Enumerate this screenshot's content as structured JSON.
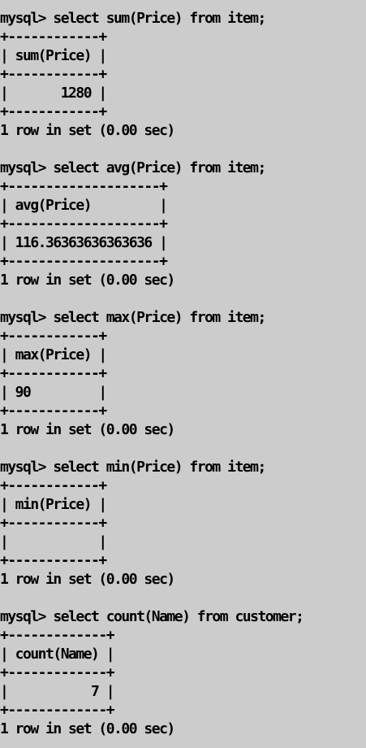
{
  "terminal": {
    "lines": [
      "mysql> select sum(Price) from item;",
      "+------------+",
      "| sum(Price) |",
      "+------------+",
      "|       1280 |",
      "+------------+",
      "1 row in set (0.00 sec)",
      "",
      "mysql> select avg(Price) from item;",
      "+--------------------+",
      "| avg(Price)         |",
      "+--------------------+",
      "| 116.36363636363636 |",
      "+--------------------+",
      "1 row in set (0.00 sec)",
      "",
      "mysql> select max(Price) from item;",
      "+------------+",
      "| max(Price) |",
      "+------------+",
      "| 90         |",
      "+------------+",
      "1 row in set (0.00 sec)",
      "",
      "mysql> select min(Price) from item;",
      "+------------+",
      "| min(Price) |",
      "+------------+",
      "|            |",
      "+------------+",
      "1 row in set (0.00 sec)",
      "",
      "mysql> select count(Name) from customer;",
      "+-------------+",
      "| count(Name) |",
      "+-------------+",
      "|           7 |",
      "+-------------+",
      "1 row in set (0.00 sec)"
    ]
  }
}
